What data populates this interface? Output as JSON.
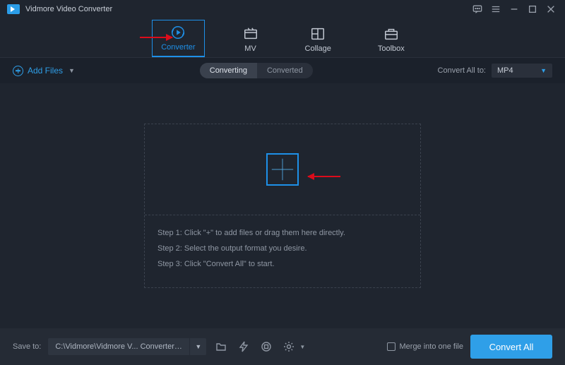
{
  "app": {
    "title": "Vidmore Video Converter"
  },
  "nav": {
    "items": [
      {
        "label": "Converter",
        "active": true
      },
      {
        "label": "MV",
        "active": false
      },
      {
        "label": "Collage",
        "active": false
      },
      {
        "label": "Toolbox",
        "active": false
      }
    ]
  },
  "toolbar": {
    "add_files": "Add Files",
    "tabs": {
      "converting": "Converting",
      "converted": "Converted"
    },
    "convert_all_to_label": "Convert All to:",
    "format_selected": "MP4"
  },
  "dropzone": {
    "step1": "Step 1: Click \"+\" to add files or drag them here directly.",
    "step2": "Step 2: Select the output format you desire.",
    "step3": "Step 3: Click \"Convert All\" to start."
  },
  "bottombar": {
    "save_to_label": "Save to:",
    "path": "C:\\Vidmore\\Vidmore V... Converter\\Converted",
    "merge_label": "Merge into one file",
    "convert_btn": "Convert All"
  }
}
